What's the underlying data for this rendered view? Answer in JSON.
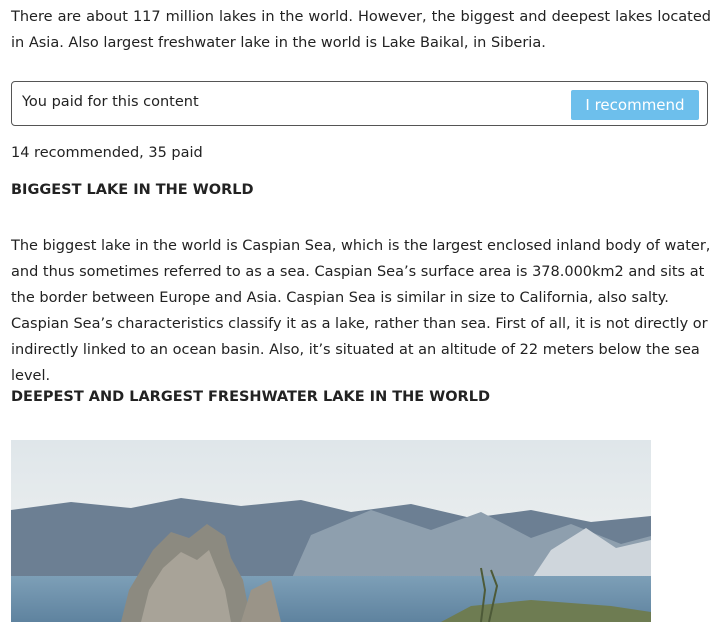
{
  "article": {
    "intro": "There are about 117 million lakes in the world. However, the biggest and deepest lakes located in Asia. Also largest freshwater lake in the world is Lake Baikal, in Siberia.",
    "payment": {
      "message": "You paid for this content",
      "button_label": "I recommend"
    },
    "stats": "14 recommended, 35 paid",
    "heading_biggest": "BIGGEST LAKE IN THE WORLD",
    "paragraph_caspian": "The biggest lake in the world is Caspian Sea, which is the largest enclosed inland body of water, and thus sometimes referred to as a sea. Caspian Sea’s surface area is 378.000km2 and sits at the border between Europe and Asia. Caspian Sea is similar in size to California, also salty. Caspian Sea’s characteristics classify it as a lake, rather than sea. First of all, it is not directly or indirectly linked to an ocean basin. Also, it’s situated at an altitude of 22 meters below the sea level.",
    "heading_deepest": "DEEPEST AND LARGEST FRESHWATER LAKE IN THE WORLD"
  },
  "colors": {
    "button": "#6dbfec",
    "text": "#222222",
    "border": "#555555"
  }
}
